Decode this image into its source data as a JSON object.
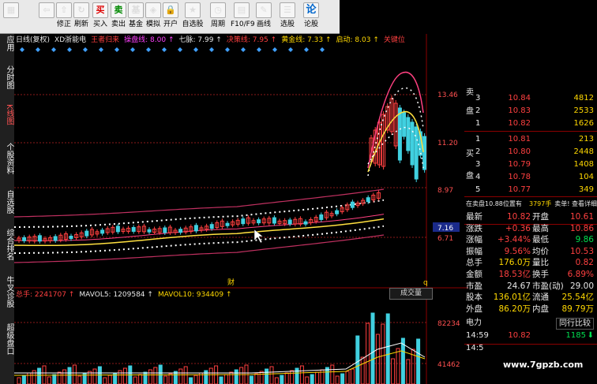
{
  "toolbar": {
    "items": [
      {
        "label": "",
        "icon": "windows-logo-icon"
      },
      {
        "label": "",
        "icon": "back-arrow-icon"
      },
      {
        "label": "修正",
        "icon": "up-arrow-icon"
      },
      {
        "label": "刷新",
        "icon": "refresh-icon"
      },
      {
        "label": "买入",
        "icon": "buy-icon"
      },
      {
        "label": "卖出",
        "icon": "sell-icon"
      },
      {
        "label": "基金",
        "icon": "fund-icon"
      },
      {
        "label": "模拟",
        "icon": "simulate-icon"
      },
      {
        "label": "开户",
        "icon": "lock-icon"
      },
      {
        "label": "自选股",
        "icon": "star-icon"
      },
      {
        "label": "周期",
        "icon": "clock-icon"
      },
      {
        "label": "F10/F9",
        "icon": "f10-icon"
      },
      {
        "label": "画线",
        "icon": "pen-icon"
      },
      {
        "label": "选股",
        "icon": "list-icon"
      },
      {
        "label": "论股",
        "icon": "forum-icon"
      }
    ]
  },
  "sidebar": {
    "items": [
      "应用",
      "分时图",
      "K线图",
      "个股资料",
      "自选股",
      "综合排名",
      "牛叉诊股",
      "超级盘口"
    ],
    "active": "K线图"
  },
  "info_bar": {
    "items": [
      {
        "text": "日线(复权)",
        "color": "#e8e8e8"
      },
      {
        "text": "XD浙能电",
        "color": "#e8e8e8"
      },
      {
        "text": "王者归来",
        "color": "#ff4040"
      },
      {
        "text": "操盘线: 8.00 ↑",
        "color": "#ff40ff"
      },
      {
        "text": "七脉: 7.99 ↑",
        "color": "#e8e8e8"
      },
      {
        "text": "决策线: 7.95 ↑",
        "color": "#ff4040"
      },
      {
        "text": "黄金线: 7.33 ↑",
        "color": "#ffd800"
      },
      {
        "text": "启动: 8.03 ↑",
        "color": "#ffd800"
      },
      {
        "text": "关键位",
        "color": "#ff4040"
      }
    ]
  },
  "price_axis": {
    "labels": [
      "13.46",
      "11.20",
      "8.97",
      "7.16",
      "6.71"
    ],
    "current": "7.16"
  },
  "chart_marks": {
    "cai": "财",
    "q": "q"
  },
  "volume": {
    "info": [
      {
        "text": "总手: 2241707 ↑",
        "color": "#ff4040"
      },
      {
        "text": "MAVOL5: 1209584 ↑",
        "color": "#e8e8e8"
      },
      {
        "text": "MAVOL10: 934409 ↑",
        "color": "#ffd800"
      }
    ],
    "button": "成交量",
    "axis": [
      "82234",
      "41462"
    ]
  },
  "order_book": {
    "sell_label": [
      "卖",
      "盘"
    ],
    "buy_label": [
      "买",
      "盘"
    ],
    "sell": [
      {
        "n": "3",
        "price": "10.84",
        "vol": "4812"
      },
      {
        "n": "2",
        "price": "10.83",
        "vol": "2533"
      },
      {
        "n": "1",
        "price": "10.82",
        "vol": "1626"
      }
    ],
    "buy": [
      {
        "n": "1",
        "price": "10.81",
        "vol": "213"
      },
      {
        "n": "2",
        "price": "10.80",
        "vol": "2448"
      },
      {
        "n": "3",
        "price": "10.79",
        "vol": "1408"
      },
      {
        "n": "4",
        "price": "10.78",
        "vol": "104"
      },
      {
        "n": "5",
        "price": "10.77",
        "vol": "349"
      }
    ]
  },
  "notice": {
    "left": "在卖盘10.88位置有",
    "mid": "3797手",
    "right": "卖单! 查看详细"
  },
  "stats": [
    {
      "k1": "最新",
      "v1": "10.82",
      "k2": "开盘",
      "v2": "10.61"
    },
    {
      "k1": "涨跌",
      "v1": "+0.36",
      "k2": "最高",
      "v2": "10.86"
    },
    {
      "k1": "涨幅",
      "v1": "+3.44%",
      "k2": "最低",
      "v2": "9.86"
    },
    {
      "k1": "振幅",
      "v1": "9.56%",
      "k2": "均价",
      "v2": "10.53"
    },
    {
      "k1": "总手",
      "v1": "176.0万",
      "k2": "量比",
      "v2": "0.82"
    },
    {
      "k1": "金额",
      "v1": "18.53亿",
      "k2": "换手",
      "v2": "6.89%"
    },
    {
      "k1": "市盈",
      "v1": "24.67",
      "k2": "市盈(动)",
      "v2": "29.00"
    },
    {
      "k1": "股本",
      "v1": "136.01亿",
      "k2": "流通",
      "v2": "25.54亿"
    },
    {
      "k1": "外盘",
      "v1": "86.20万",
      "k2": "内盘",
      "v2": "89.79万"
    }
  ],
  "tabs": {
    "left": "电力",
    "right": "同行比较"
  },
  "tick": {
    "time": "14:59",
    "price": "10.82",
    "vol": "1185",
    "time2": "14:5"
  },
  "watermark": "www.7gpzb.com"
}
